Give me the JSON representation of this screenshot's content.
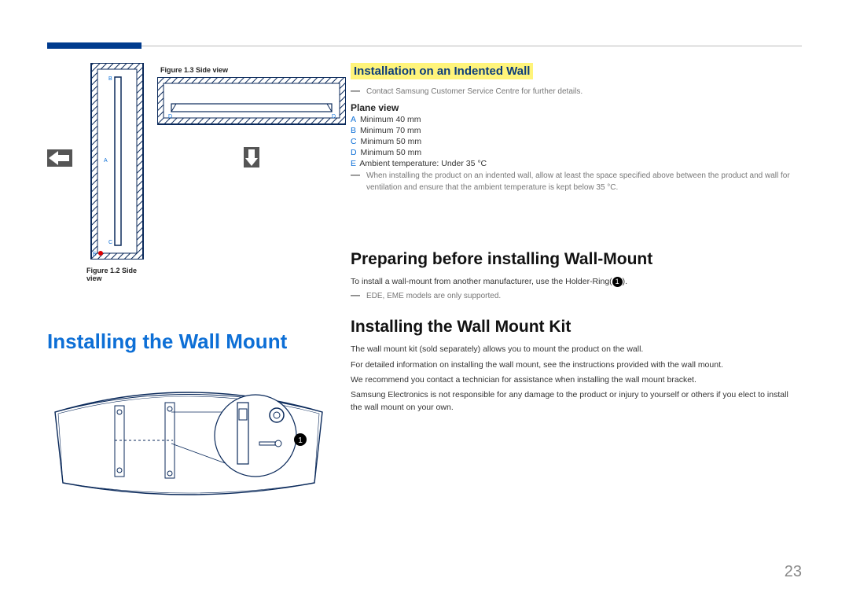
{
  "page_number": "23",
  "figures": {
    "fig12_caption": "Figure 1.2 Side view",
    "fig13_caption": "Figure 1.3 Side view",
    "labels": {
      "A": "A",
      "B": "B",
      "C": "C",
      "D": "D",
      "E": "E"
    }
  },
  "col_right": {
    "install_indented_title": "Installation on an Indented Wall",
    "contact_note": "Contact Samsung Customer Service Centre for further details.",
    "plane_view_title": "Plane view",
    "specs": [
      {
        "label": "A",
        "text": "Minimum 40 mm"
      },
      {
        "label": "B",
        "text": "Minimum 70 mm"
      },
      {
        "label": "C",
        "text": "Minimum 50 mm"
      },
      {
        "label": "D",
        "text": "Minimum 50 mm"
      },
      {
        "label": "E",
        "text": "Ambient temperature: Under 35 °C"
      }
    ],
    "vent_note": "When installing the product on an indented wall, allow at least the space specified above between the product and wall for ventilation and ensure that the ambient temperature is kept below 35 °C.",
    "prepare_title": "Preparing before installing Wall-Mount",
    "prepare_text_pre": "To install a wall-mount from another manufacturer, use the Holder-Ring(",
    "prepare_text_post": ").",
    "ede_note": "EDE, EME models are only supported.",
    "kit_title": "Installing the Wall Mount Kit",
    "kit_paras": [
      "The wall mount kit (sold separately) allows you to mount the product on the wall.",
      "For detailed information on installing the wall mount, see the instructions provided with the wall mount.",
      "We recommend you contact a technician for assistance when installing the wall mount bracket.",
      "Samsung Electronics is not responsible for any damage to the product or injury to yourself or others if you elect to install the wall mount on your own."
    ]
  },
  "col_left": {
    "main_title": "Installing the Wall Mount",
    "circ1": "1"
  }
}
